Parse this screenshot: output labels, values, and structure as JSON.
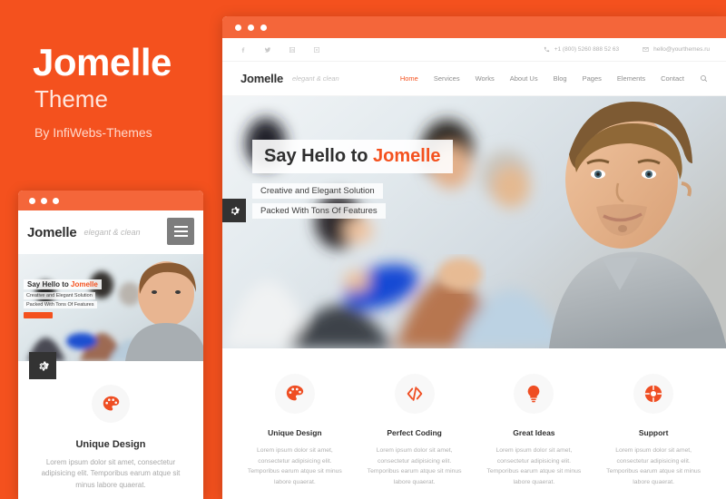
{
  "promo": {
    "title": "Jomelle",
    "subtitle": "Theme",
    "author": "By InfiWebs-Themes"
  },
  "colors": {
    "accent": "#f4511e",
    "titlebar": "#f4663a",
    "dark_button": "#333333",
    "heading": "#2f2f2f",
    "muted_text": "#b0b0b0"
  },
  "mobile": {
    "window_dots": [
      "dot-1",
      "dot-2",
      "dot-3"
    ],
    "logo": "Jomelle",
    "tagline": "elegant & clean",
    "menu_icon": "hamburger-icon",
    "settings_icon": "gear-icon",
    "hero": {
      "headline_prefix": "Say Hello to ",
      "headline_brand": "Jomelle",
      "line1": "Creative and Elegant Solution",
      "line2": "Packed With Tons Of Features"
    },
    "feature": {
      "icon": "palette-icon",
      "title": "Unique Design",
      "text": "Lorem ipsum dolor sit amet, consectetur adipisicing elit. Temporibus earum atque sit minus labore quaerat."
    }
  },
  "desktop": {
    "window_dots": [
      "dot-1",
      "dot-2",
      "dot-3"
    ],
    "topbar": {
      "socials": [
        {
          "name": "facebook-icon",
          "glyph": "f"
        },
        {
          "name": "twitter-icon",
          "glyph": "t"
        },
        {
          "name": "linkedin-icon",
          "glyph": "in"
        },
        {
          "name": "google-plus-icon",
          "glyph": "g"
        }
      ],
      "phone": "+1 (800) 5260 888 52 63",
      "phone_icon": "phone-icon",
      "email": "hello@yourthemes.ru",
      "email_icon": "envelope-icon"
    },
    "nav": {
      "logo": "Jomelle",
      "tagline": "elegant & clean",
      "search_icon": "search-icon",
      "items": [
        {
          "label": "Home",
          "active": true
        },
        {
          "label": "Services",
          "active": false
        },
        {
          "label": "Works",
          "active": false
        },
        {
          "label": "About Us",
          "active": false
        },
        {
          "label": "Blog",
          "active": false
        },
        {
          "label": "Pages",
          "active": false
        },
        {
          "label": "Elements",
          "active": false
        },
        {
          "label": "Contact",
          "active": false
        }
      ]
    },
    "hero": {
      "headline_prefix": "Say Hello to ",
      "headline_brand": "Jomelle",
      "line1": "Creative and Elegant Solution",
      "line2": "Packed With Tons Of Features",
      "settings_icon": "gear-icon"
    },
    "features": [
      {
        "icon": "palette-icon",
        "title": "Unique Design",
        "text": "Lorem ipsum dolor sit amet, consectetur adipisicing elit. Temporibus earum atque sit minus labore quaerat."
      },
      {
        "icon": "code-icon",
        "title": "Perfect Coding",
        "text": "Lorem ipsum dolor sit amet, consectetur adipisicing elit. Temporibus earum atque sit minus labore quaerat."
      },
      {
        "icon": "lightbulb-icon",
        "title": "Great Ideas",
        "text": "Lorem ipsum dolor sit amet, consectetur adipisicing elit. Temporibus earum atque sit minus labore quaerat."
      },
      {
        "icon": "lifebuoy-icon",
        "title": "Support",
        "text": "Lorem ipsum dolor sit amet, consectetur adipisicing elit. Temporibus earum atque sit minus labore quaerat."
      }
    ]
  }
}
